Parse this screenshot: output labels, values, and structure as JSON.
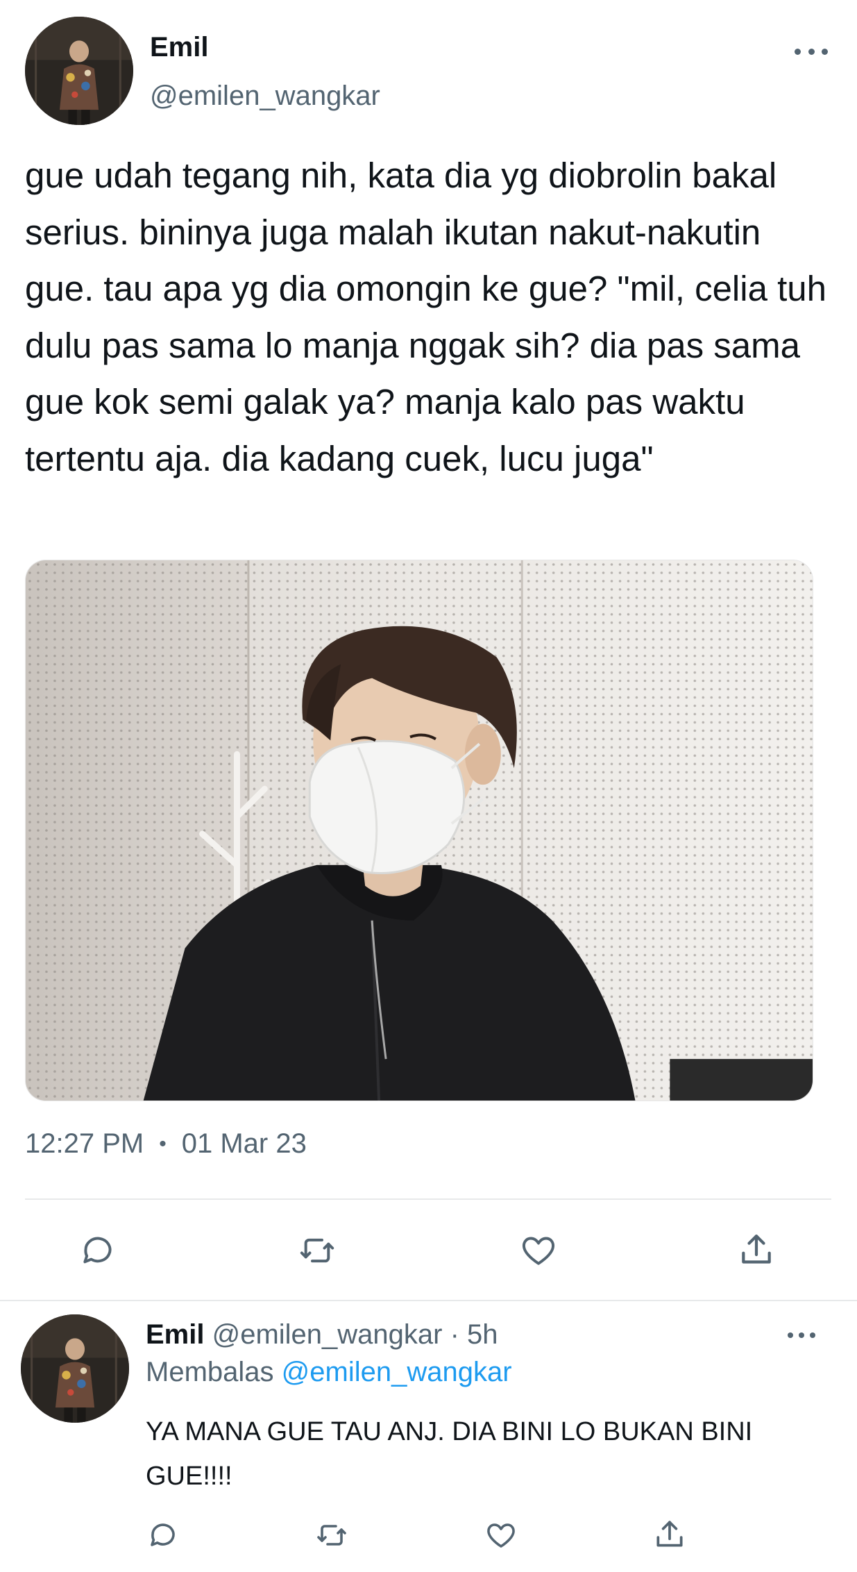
{
  "tweet": {
    "author_name": "Emil",
    "author_handle": "@emilen_wangkar",
    "text": "gue udah tegang nih, kata dia yg diobrolin bakal serius. bininya juga malah ikutan nakut-nakutin gue. tau apa yg dia omongin ke gue? \"mil, celia tuh dulu pas sama lo manja nggak sih? dia pas sama gue kok semi galak ya? manja kalo pas waktu tertentu aja. dia kadang cuek, lucu juga\"",
    "time": "12:27 PM",
    "separator": "•",
    "date": "01 Mar 23"
  },
  "reply": {
    "author_name": "Emil",
    "author_handle": "@emilen_wangkar",
    "age": "· 5h",
    "replying_label": "Membalas",
    "replying_to": "@emilen_wangkar",
    "text": "YA MANA GUE TAU ANJ. DIA BINI LO BUKAN BINI GUE!!!!"
  },
  "icons": {
    "more": "more-horizontal-icon",
    "reply": "reply-bubble-icon",
    "retweet": "retweet-icon",
    "like": "heart-icon",
    "share": "share-upload-icon"
  },
  "colors": {
    "text": "#0f1419",
    "secondary": "#536471",
    "link": "#1d9bf0",
    "divider": "#e7e9ea"
  }
}
